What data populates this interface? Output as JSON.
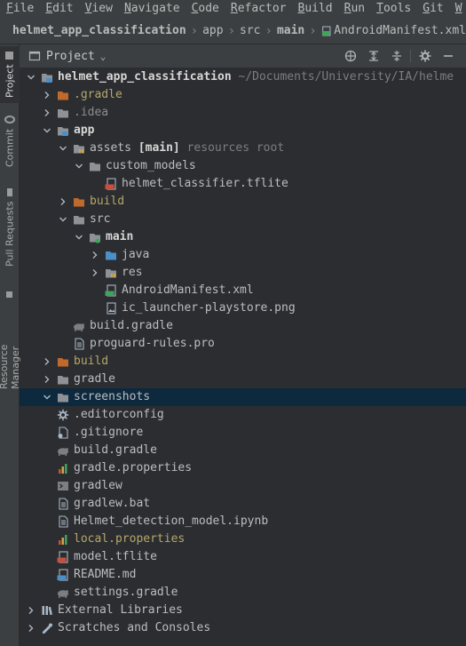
{
  "menu": [
    "File",
    "Edit",
    "View",
    "Navigate",
    "Code",
    "Refactor",
    "Build",
    "Run",
    "Tools",
    "Git",
    "W"
  ],
  "breadcrumb": {
    "items": [
      "helmet_app_classification",
      "app",
      "src",
      "main"
    ],
    "file": "AndroidManifest.xml"
  },
  "side_tabs": [
    "Project",
    "Commit",
    "Pull Requests",
    "Resource Manager"
  ],
  "panel": {
    "title": "Project",
    "icons": [
      "globe-icon",
      "collapse-all-icon",
      "expand-all-icon",
      "gear-icon",
      "hide-icon"
    ]
  },
  "tree": [
    {
      "label": "helmet_app_classification",
      "suffix": "~/Documents/University/IA/helme",
      "depth": 0,
      "expanded": true,
      "icon": "module",
      "style": "bold"
    },
    {
      "label": ".gradle",
      "depth": 1,
      "expanded": false,
      "icon": "folder-orange",
      "style": "olive"
    },
    {
      "label": ".idea",
      "depth": 1,
      "expanded": false,
      "icon": "folder",
      "style": "gray"
    },
    {
      "label": "app",
      "depth": 1,
      "expanded": true,
      "icon": "module",
      "style": "bold"
    },
    {
      "label": "assets",
      "tag": "[main]",
      "suffix": "resources root",
      "depth": 2,
      "expanded": true,
      "icon": "resfolder",
      "style": "normal"
    },
    {
      "label": "custom_models",
      "depth": 3,
      "expanded": true,
      "icon": "folder",
      "style": "normal"
    },
    {
      "label": "helmet_classifier.tflite",
      "depth": 4,
      "icon": "tfl",
      "style": "normal"
    },
    {
      "label": "build",
      "depth": 2,
      "expanded": false,
      "icon": "folder-orange",
      "style": "olive"
    },
    {
      "label": "src",
      "depth": 2,
      "expanded": true,
      "icon": "folder",
      "style": "normal"
    },
    {
      "label": "main",
      "depth": 3,
      "expanded": true,
      "icon": "srcfolder",
      "style": "bold"
    },
    {
      "label": "java",
      "depth": 4,
      "expanded": false,
      "icon": "folder-blue",
      "style": "normal"
    },
    {
      "label": "res",
      "depth": 4,
      "expanded": false,
      "icon": "resfolder",
      "style": "normal"
    },
    {
      "label": "AndroidManifest.xml",
      "depth": 4,
      "icon": "manifest",
      "style": "normal"
    },
    {
      "label": "ic_launcher-playstore.png",
      "depth": 4,
      "icon": "image",
      "style": "normal"
    },
    {
      "label": "build.gradle",
      "depth": 2,
      "icon": "gradle",
      "style": "normal"
    },
    {
      "label": "proguard-rules.pro",
      "depth": 2,
      "icon": "file",
      "style": "normal"
    },
    {
      "label": "build",
      "depth": 1,
      "expanded": false,
      "icon": "folder-orange",
      "style": "olive"
    },
    {
      "label": "gradle",
      "depth": 1,
      "expanded": false,
      "icon": "folder",
      "style": "normal"
    },
    {
      "label": "screenshots",
      "depth": 1,
      "expanded": true,
      "icon": "folder",
      "style": "normal",
      "selected": true
    },
    {
      "label": ".editorconfig",
      "depth": 1,
      "icon": "gear",
      "style": "normal"
    },
    {
      "label": ".gitignore",
      "depth": 1,
      "icon": "gitfile",
      "style": "normal"
    },
    {
      "label": "build.gradle",
      "depth": 1,
      "icon": "gradle",
      "style": "normal"
    },
    {
      "label": "gradle.properties",
      "depth": 1,
      "icon": "properties",
      "style": "normal"
    },
    {
      "label": "gradlew",
      "depth": 1,
      "icon": "terminal",
      "style": "normal"
    },
    {
      "label": "gradlew.bat",
      "depth": 1,
      "icon": "file",
      "style": "normal"
    },
    {
      "label": "Helmet_detection_model.ipynb",
      "depth": 1,
      "icon": "file",
      "style": "normal"
    },
    {
      "label": "local.properties",
      "depth": 1,
      "icon": "properties",
      "style": "olive"
    },
    {
      "label": "model.tflite",
      "depth": 1,
      "icon": "tfl",
      "style": "normal"
    },
    {
      "label": "README.md",
      "depth": 1,
      "icon": "md",
      "style": "normal"
    },
    {
      "label": "settings.gradle",
      "depth": 1,
      "icon": "gradle",
      "style": "normal"
    },
    {
      "label": "External Libraries",
      "depth": 0,
      "expanded": false,
      "icon": "libraries",
      "style": "normal"
    },
    {
      "label": "Scratches and Consoles",
      "depth": 0,
      "expanded": false,
      "icon": "scratches",
      "style": "normal"
    }
  ],
  "colors": {
    "background": "#2b2d30",
    "selection": "#0d293e",
    "excluded_folder": "#c0692c",
    "module_badge": "#3fa55c"
  }
}
